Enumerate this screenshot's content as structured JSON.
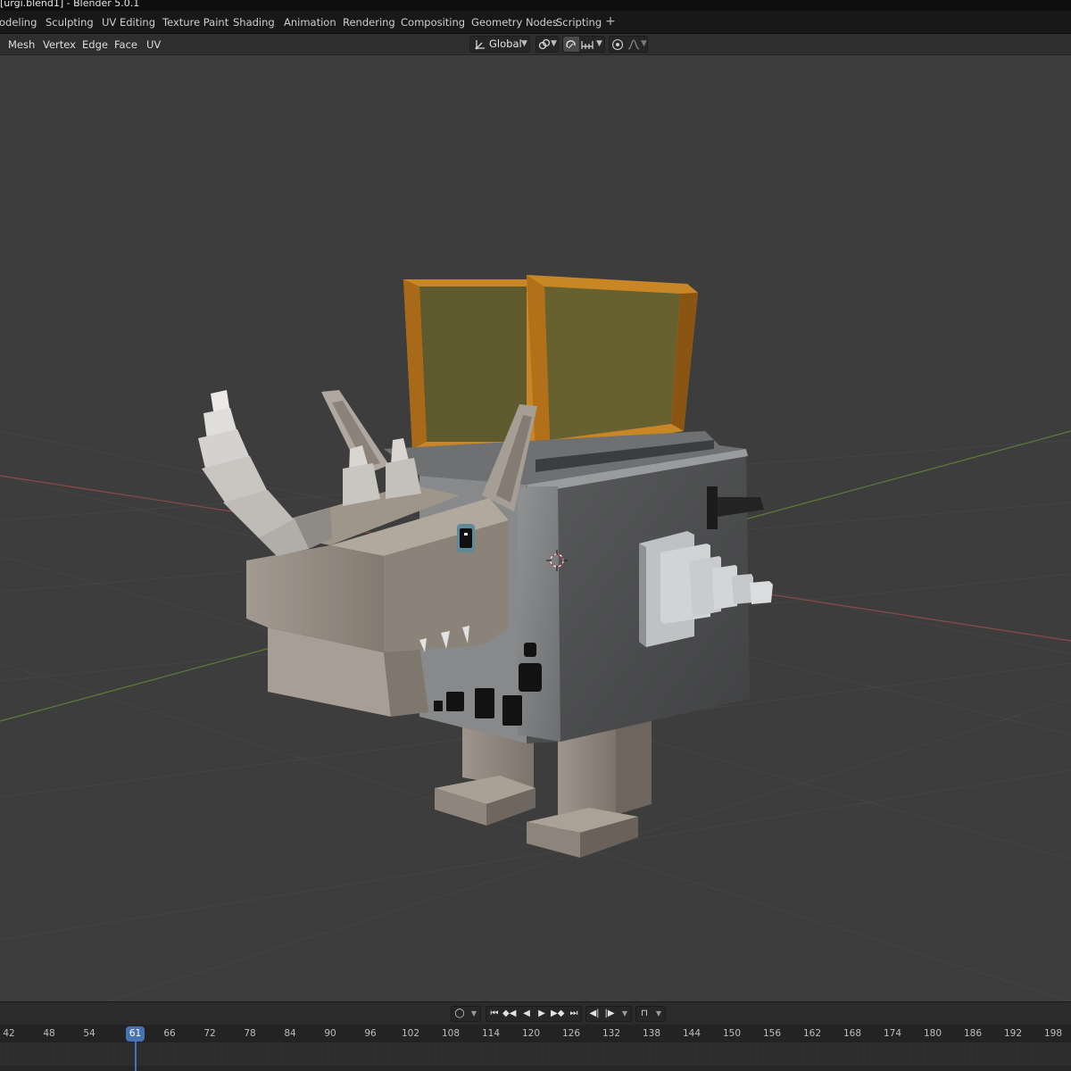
{
  "window": {
    "title": "[urgi.blend1] - Blender 5.0.1"
  },
  "workspaces": [
    {
      "label": "odeling"
    },
    {
      "label": "Sculpting"
    },
    {
      "label": "UV Editing"
    },
    {
      "label": "Texture Paint"
    },
    {
      "label": "Shading"
    },
    {
      "label": "Animation"
    },
    {
      "label": "Rendering"
    },
    {
      "label": "Compositing"
    },
    {
      "label": "Geometry Nodes"
    },
    {
      "label": "Scripting"
    }
  ],
  "header": {
    "menus": [
      {
        "label": "Mesh"
      },
      {
        "label": "Vertex"
      },
      {
        "label": "Edge"
      },
      {
        "label": "Face"
      },
      {
        "label": "UV"
      }
    ],
    "transform_orientation": "Global",
    "icons": [
      "orientation-icon",
      "pivot-link-icon",
      "snap-icon",
      "snap-increment-icon",
      "proportional-edit-icon",
      "falloff-icon"
    ]
  },
  "timeline": {
    "current_frame": "61",
    "ticks": [
      "42",
      "48",
      "54",
      "66",
      "72",
      "78",
      "84",
      "90",
      "96",
      "102",
      "108",
      "114",
      "120",
      "126",
      "132",
      "138",
      "144",
      "150",
      "156",
      "162",
      "168",
      "174",
      "180",
      "186",
      "192",
      "198"
    ],
    "playback_icons": [
      "keying-icon",
      "jump-start-icon",
      "prev-keyframe-icon",
      "play-reverse-icon",
      "play-icon",
      "next-keyframe-icon",
      "jump-end-icon",
      "prev-marker-icon",
      "next-marker-icon",
      "auto-keying-icon"
    ]
  },
  "colors": {
    "viewport_bg": "#3d3d3d",
    "grid_line": "#454545",
    "x_axis": "#8b4b4b",
    "y_axis": "#5e7d3a",
    "frame_marker": "#4772b3",
    "toast_bread": "#c98624",
    "body_grey": "#8a8c8e",
    "head_tan": "#a69c92"
  }
}
